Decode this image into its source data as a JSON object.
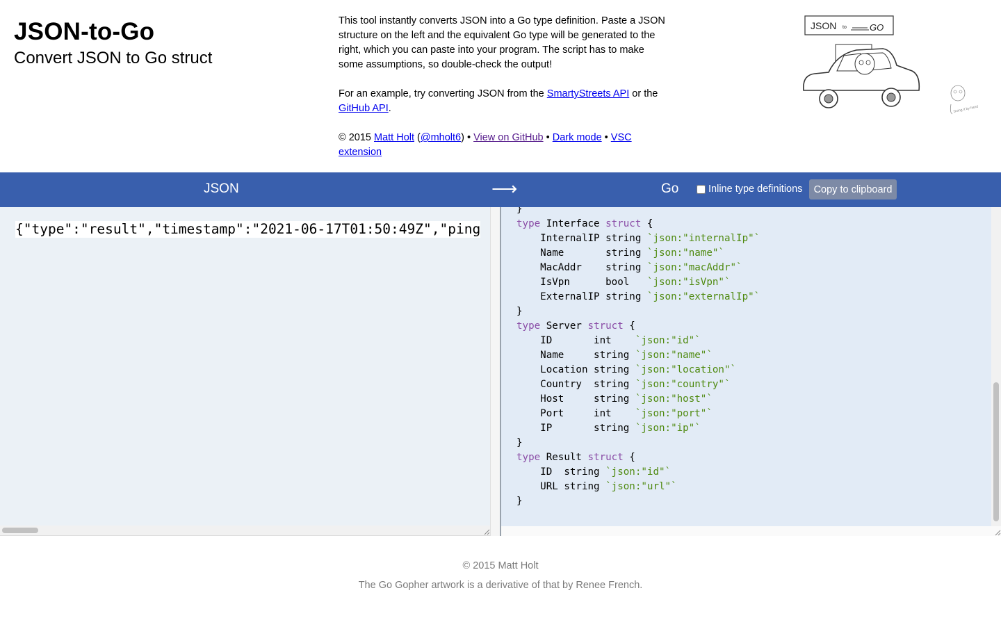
{
  "header": {
    "title": "JSON-to-Go",
    "subtitle": "Convert JSON to Go struct",
    "desc_paragraph_1": "This tool instantly converts JSON into a Go type definition. Paste a JSON structure on the left and the equivalent Go type will be generated to the right, which you can paste into your program. The script has to make some assumptions, so double-check the output!",
    "example_prefix": "For an example, try converting JSON from the ",
    "example_link_1": "SmartyStreets API",
    "example_middle": " or the ",
    "example_link_2": "GitHub API",
    "example_suffix": ".",
    "credit_prefix": "© 2015 ",
    "credit_author": "Matt Holt",
    "credit_handle_open": " (",
    "credit_handle": "@mholt6",
    "credit_handle_close": ") • ",
    "link_github": "View on GitHub",
    "sep": " • ",
    "link_dark": "Dark mode",
    "link_vsc": "VSC extension",
    "logo_text_json": "JSON",
    "logo_text_to": "to",
    "logo_text_go": "GO",
    "doodle_text": "Doing it by hand"
  },
  "bar": {
    "json_label": "JSON",
    "arrow": "⟶",
    "go_label": "Go",
    "inline_label": "Inline type definitions",
    "copy_label": "Copy to clipboard",
    "inline_checked": false
  },
  "input": {
    "json_text": "{\"type\":\"result\",\"timestamp\":\"2021-06-17T01:50:49Z\",\"ping"
  },
  "output": {
    "lines": [
      [
        {
          "t": "}",
          "c": ""
        }
      ],
      [
        {
          "t": "type",
          "c": "kw"
        },
        {
          "t": " Interface ",
          "c": ""
        },
        {
          "t": "struct",
          "c": "kw"
        },
        {
          "t": " {",
          "c": ""
        }
      ],
      [
        {
          "t": "    InternalIP string ",
          "c": ""
        },
        {
          "t": "`json:\"internalIp\"`",
          "c": "tag"
        }
      ],
      [
        {
          "t": "    Name       string ",
          "c": ""
        },
        {
          "t": "`json:\"name\"`",
          "c": "tag"
        }
      ],
      [
        {
          "t": "    MacAddr    string ",
          "c": ""
        },
        {
          "t": "`json:\"macAddr\"`",
          "c": "tag"
        }
      ],
      [
        {
          "t": "    IsVpn      bool   ",
          "c": ""
        },
        {
          "t": "`json:\"isVpn\"`",
          "c": "tag"
        }
      ],
      [
        {
          "t": "    ExternalIP string ",
          "c": ""
        },
        {
          "t": "`json:\"externalIp\"`",
          "c": "tag"
        }
      ],
      [
        {
          "t": "}",
          "c": ""
        }
      ],
      [
        {
          "t": "type",
          "c": "kw"
        },
        {
          "t": " Server ",
          "c": ""
        },
        {
          "t": "struct",
          "c": "kw"
        },
        {
          "t": " {",
          "c": ""
        }
      ],
      [
        {
          "t": "    ID       int    ",
          "c": ""
        },
        {
          "t": "`json:\"id\"`",
          "c": "tag"
        }
      ],
      [
        {
          "t": "    Name     string ",
          "c": ""
        },
        {
          "t": "`json:\"name\"`",
          "c": "tag"
        }
      ],
      [
        {
          "t": "    Location string ",
          "c": ""
        },
        {
          "t": "`json:\"location\"`",
          "c": "tag"
        }
      ],
      [
        {
          "t": "    Country  string ",
          "c": ""
        },
        {
          "t": "`json:\"country\"`",
          "c": "tag"
        }
      ],
      [
        {
          "t": "    Host     string ",
          "c": ""
        },
        {
          "t": "`json:\"host\"`",
          "c": "tag"
        }
      ],
      [
        {
          "t": "    Port     int    ",
          "c": ""
        },
        {
          "t": "`json:\"port\"`",
          "c": "tag"
        }
      ],
      [
        {
          "t": "    IP       string ",
          "c": ""
        },
        {
          "t": "`json:\"ip\"`",
          "c": "tag"
        }
      ],
      [
        {
          "t": "}",
          "c": ""
        }
      ],
      [
        {
          "t": "type",
          "c": "kw"
        },
        {
          "t": " Result ",
          "c": ""
        },
        {
          "t": "struct",
          "c": "kw"
        },
        {
          "t": " {",
          "c": ""
        }
      ],
      [
        {
          "t": "    ID  string ",
          "c": ""
        },
        {
          "t": "`json:\"id\"`",
          "c": "tag"
        }
      ],
      [
        {
          "t": "    URL string ",
          "c": ""
        },
        {
          "t": "`json:\"url\"`",
          "c": "tag"
        }
      ],
      [
        {
          "t": "}",
          "c": ""
        }
      ]
    ]
  },
  "footer": {
    "copyright": "© 2015 Matt Holt",
    "attribution": "The Go Gopher artwork is a derivative of that by Renee French."
  },
  "colors": {
    "bar_bg": "#395fad",
    "left_bg": "#ebf1f6",
    "right_bg": "#e2ebf6",
    "keyword": "#8a4ca6",
    "tag": "#4f8a10",
    "link": "#0000ee",
    "visited": "#551a8b"
  }
}
